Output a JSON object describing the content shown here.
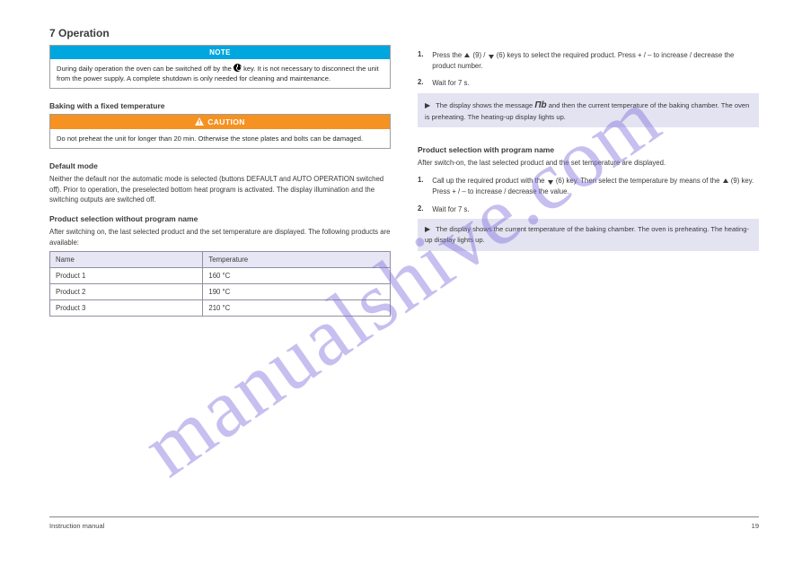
{
  "watermark": "manualshive.com",
  "left": {
    "section_title": "7 Operation",
    "note": {
      "header": "NOTE",
      "body_1": "During daily operation the oven can be switched off by the ",
      "body_2": "key. It is not necessary to disconnect the unit from the power supply. A complete shutdown is only needed for cleaning and maintenance."
    },
    "baking_title": "Baking with a fixed temperature",
    "warning": {
      "header": "CAUTION",
      "body": "Do not preheat the unit for longer than 20 min. Otherwise the stone plates and bolts can be damaged."
    },
    "default_heading": "Default mode",
    "default_text": "Neither the default nor the automatic mode is selected (buttons DEFAULT and AUTO OPERATION switched off). Prior to operation, the preselected bottom heat program is activated. The display illumination and the switching outputs are switched off.",
    "product_heading": "Product selection without program name",
    "product_text": "After switching on, the last selected product and the set temperature are displayed. The following products are available:",
    "table": {
      "h1": "Name",
      "h2": "Temperature",
      "r1c1": "Product 1",
      "r1c2": "160 °C",
      "r2c1": "Product 2",
      "r2c2": "190 °C",
      "r3c1": "Product 3",
      "r3c2": "210 °C"
    }
  },
  "right": {
    "proc1_step1_num": "1.",
    "proc1_step1_txt_a": "Press the ",
    "proc1_step1_txt_b": " (9) / ",
    "proc1_step1_txt_c": " (6) keys to select the required product. Press + / – to increase / decrease the product number.",
    "proc1_step2_num": "2.",
    "proc1_step2_txt": "Wait for 7 s.",
    "proc1_result_a": "The display shows the message ",
    "proc1_result_b": " and then the current temperature of the baking chamber. The oven is preheating. The heating-up display lights up.",
    "nb_glyph": "Пb",
    "proc2_heading": "Product selection with program name",
    "proc2_text": "After switch-on, the last selected product and the set temperature are displayed.",
    "proc2_step1_num": "1.",
    "proc2_step1_txt_a": "Call up the required product with the ",
    "proc2_step1_txt_b": " (6) key. Then select the temperature by means of the ",
    "proc2_step1_txt_c": " (9) key. Press + / – to increase / decrease the value.",
    "proc2_step2_num": "2.",
    "proc2_step2_txt": "Wait for 7 s.",
    "proc2_result": "The display shows the current temperature of the baking chamber. The oven is preheating. The heating-up display lights up."
  },
  "footer": {
    "left": "Instruction manual",
    "right": "19"
  }
}
